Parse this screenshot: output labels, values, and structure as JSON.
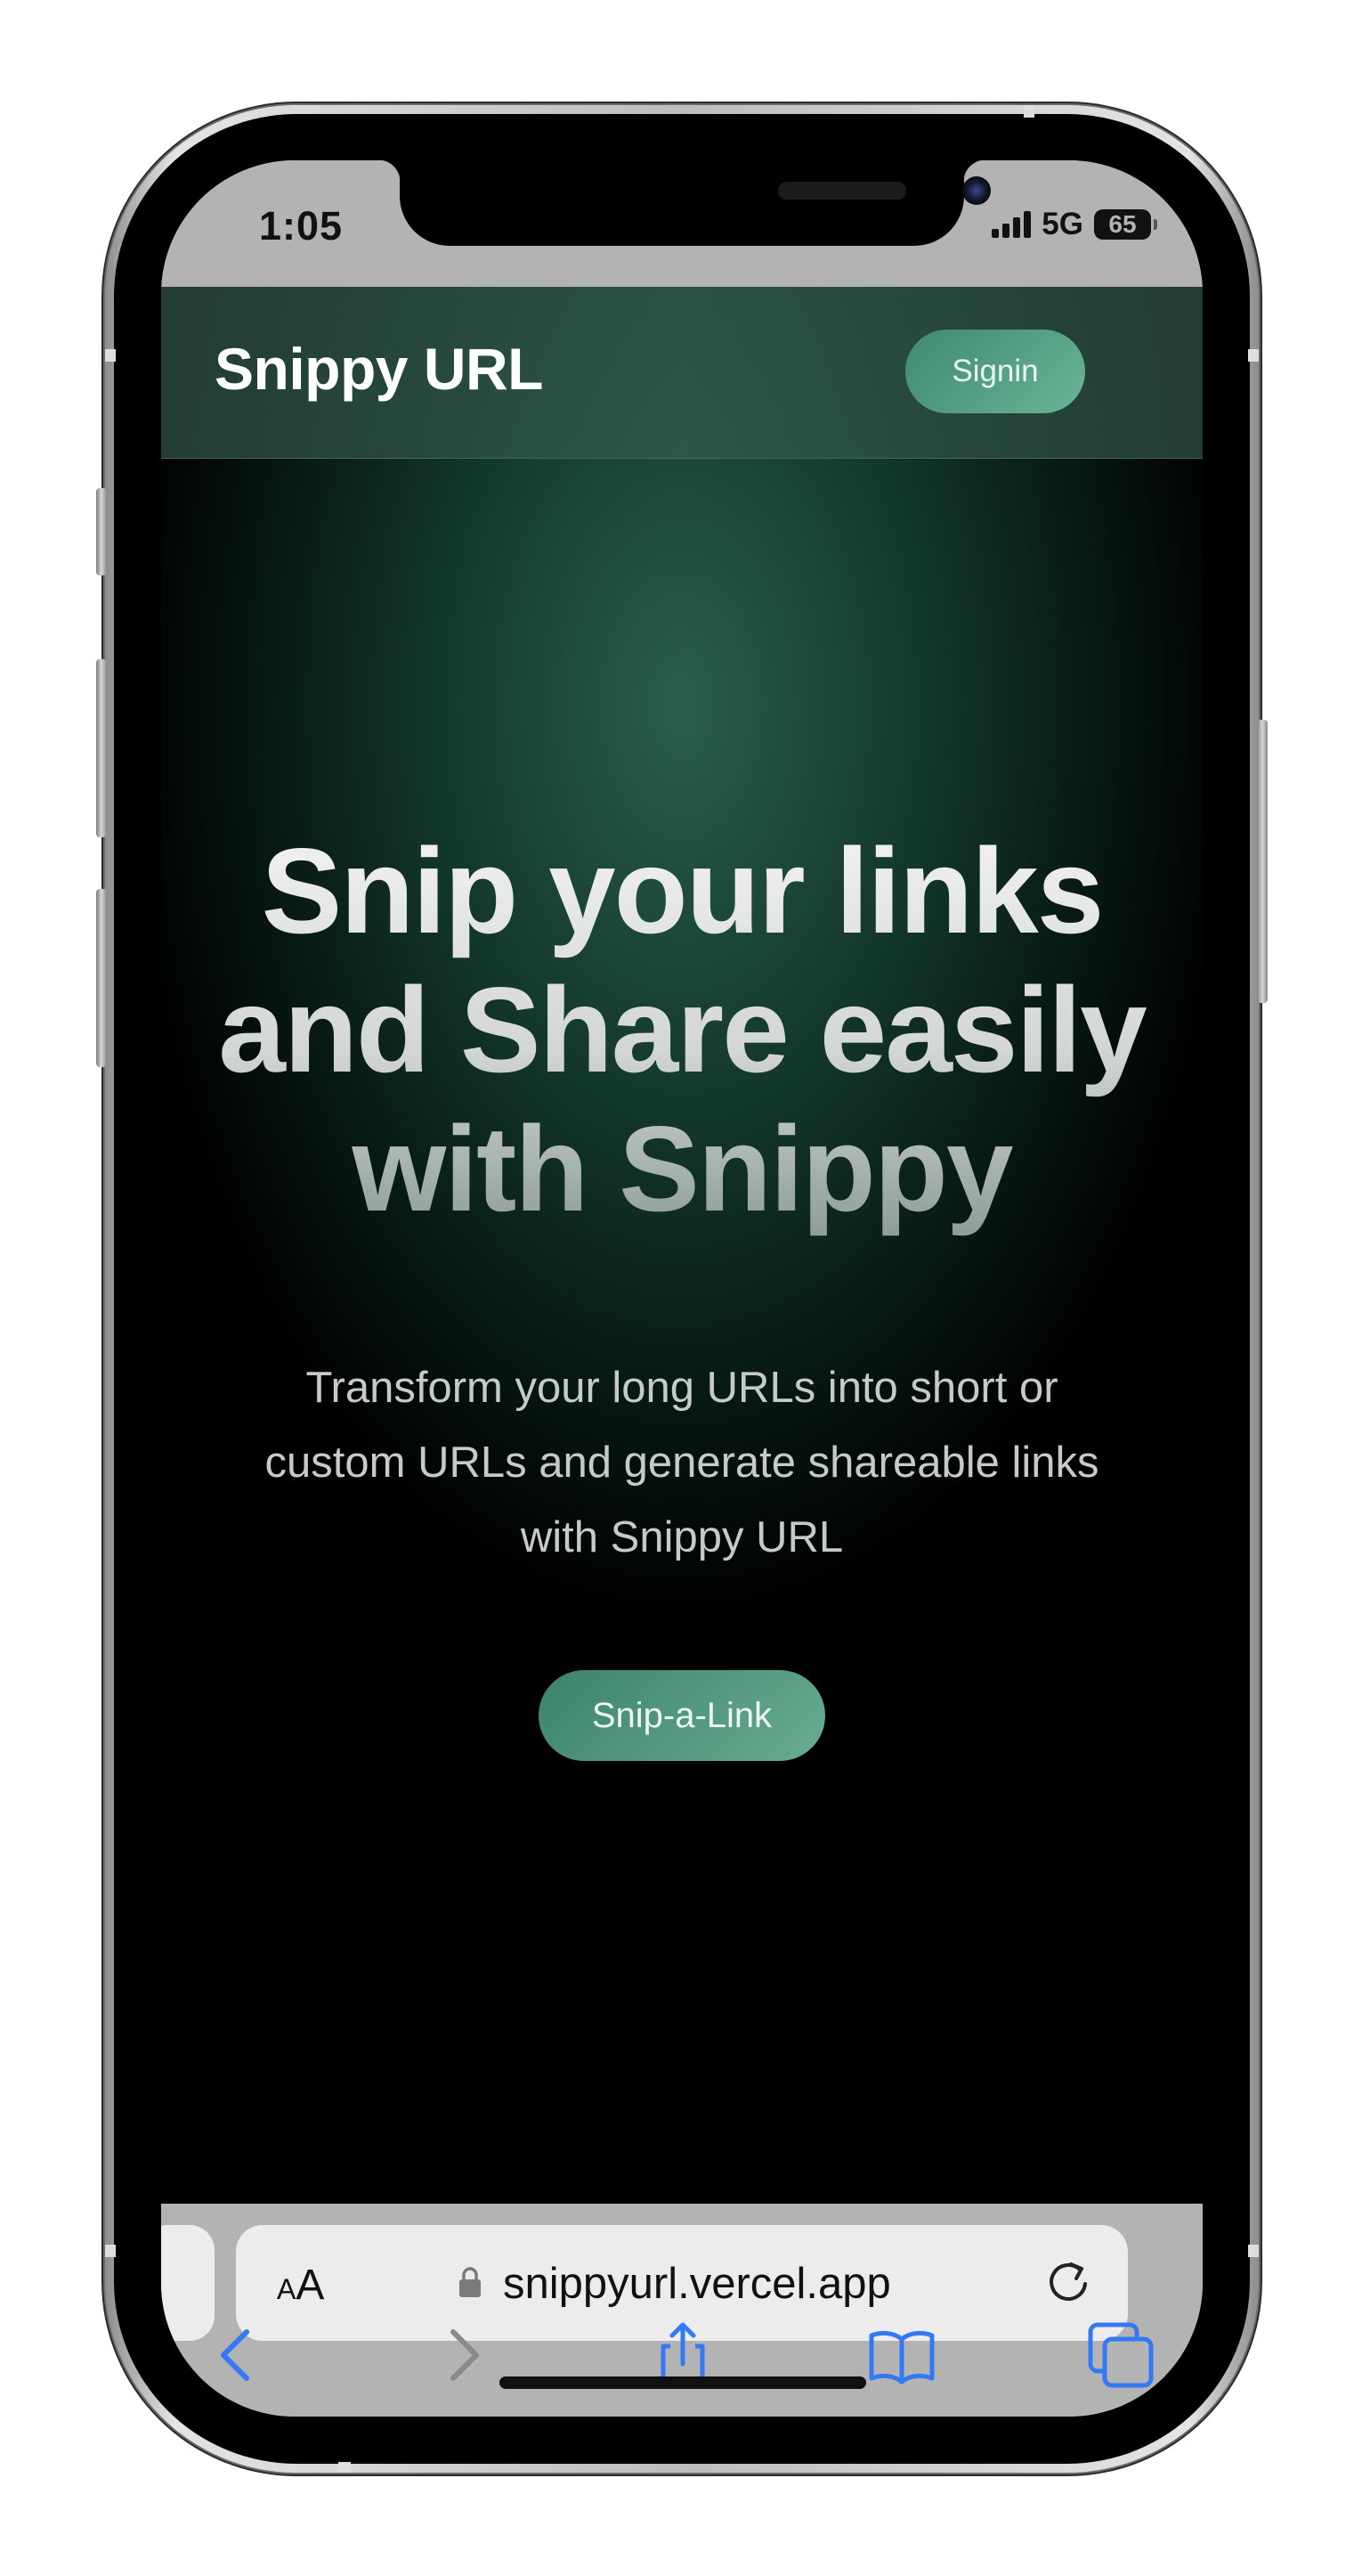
{
  "status_bar": {
    "time": "1:05",
    "network": "5G",
    "battery": "65"
  },
  "navbar": {
    "brand": "Snippy URL",
    "signin_label": "Signin"
  },
  "hero": {
    "title_lines": [
      "Snip your links",
      "and Share easily",
      "with Snippy"
    ],
    "subtitle": "Transform your long URLs into short or custom URLs and generate shareable links with Snippy URL",
    "cta_label": "Snip-a-Link"
  },
  "browser": {
    "text_size_label": "AA",
    "url": "snippyurl.vercel.app",
    "toolbar_icons": [
      "back-icon",
      "forward-icon",
      "share-icon",
      "bookmarks-icon",
      "tabs-icon"
    ]
  },
  "colors": {
    "accent": "#5a9e84",
    "background_dark": "#000000",
    "hero_glow": "#2a5e4b",
    "safari_tint": "#3478f6"
  }
}
